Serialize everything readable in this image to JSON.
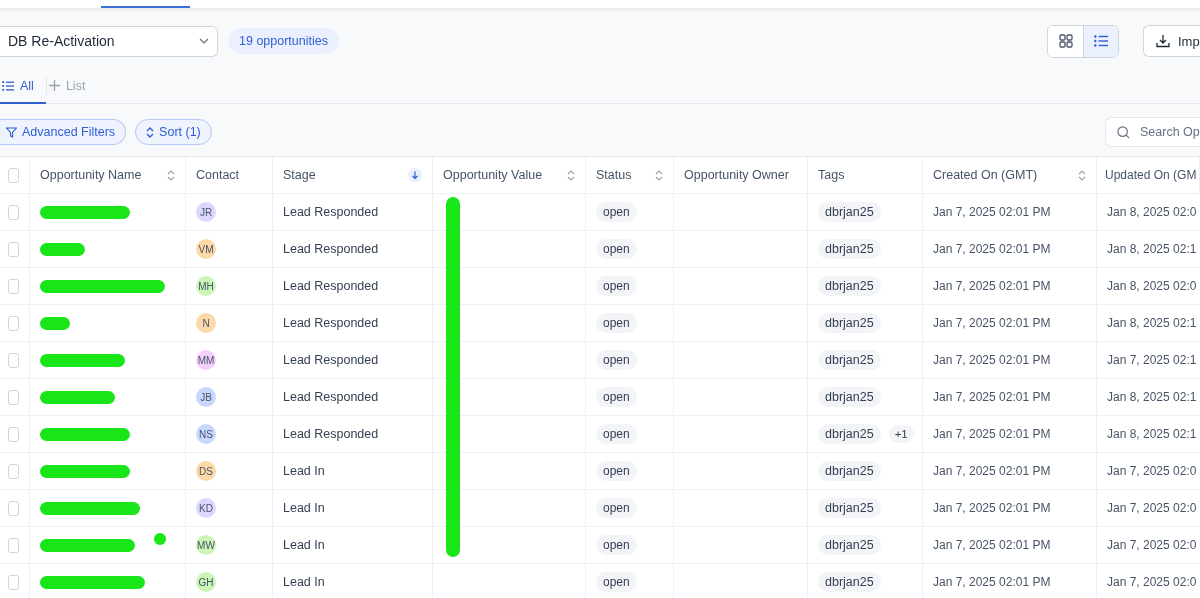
{
  "pipeline_select": {
    "value": "DB Re-Activation"
  },
  "count_badge": "19 opportunities",
  "view_toggle": [
    {
      "kind": "grid",
      "selected": false
    },
    {
      "kind": "list",
      "selected": true
    }
  ],
  "import_button": "Imp",
  "tabs": [
    {
      "label": "All",
      "kind": "list",
      "selected": true
    },
    {
      "label": "List",
      "kind": "add",
      "selected": false
    }
  ],
  "filters": [
    {
      "label": "Advanced Filters",
      "kind": "filter"
    },
    {
      "label": "Sort (1)",
      "kind": "sort"
    }
  ],
  "search": {
    "placeholder": "Search Op"
  },
  "table": {
    "all_checked": false,
    "columns": [
      {
        "label": "Opportunity Name",
        "sortable": true,
        "sorted": false
      },
      {
        "label": "Contact",
        "sortable": false,
        "sorted": false
      },
      {
        "label": "Stage",
        "sortable": false,
        "sorted": true
      },
      {
        "label": "Opportunity Value",
        "sortable": true,
        "sorted": false
      },
      {
        "label": "Status",
        "sortable": true,
        "sorted": false
      },
      {
        "label": "Opportunity Owner",
        "sortable": false,
        "sorted": false
      },
      {
        "label": "Tags",
        "sortable": false,
        "sorted": false
      },
      {
        "label": "Created On (GMT)",
        "sortable": true,
        "sorted": false
      },
      {
        "label": "Updated On (GM",
        "sortable": false,
        "sorted": false
      }
    ],
    "rows": [
      {
        "checked": false,
        "initials": "JR",
        "color": "#ddd6fe",
        "stage": "Lead Responded",
        "status": "open",
        "tags": [
          "dbrjan25"
        ],
        "created": "Jan 7, 2025 02:01 PM",
        "updated": "Jan 8, 2025 02:0"
      },
      {
        "checked": false,
        "initials": "VM",
        "color": "#fcd9a8",
        "stage": "Lead Responded",
        "status": "open",
        "tags": [
          "dbrjan25"
        ],
        "created": "Jan 7, 2025 02:01 PM",
        "updated": "Jan 8, 2025 02:1"
      },
      {
        "checked": false,
        "initials": "MH",
        "color": "#ccf5b8",
        "stage": "Lead Responded",
        "status": "open",
        "tags": [
          "dbrjan25"
        ],
        "created": "Jan 7, 2025 02:01 PM",
        "updated": "Jan 8, 2025 02:0"
      },
      {
        "checked": false,
        "initials": "N",
        "color": "#fcd9a8",
        "stage": "Lead Responded",
        "status": "open",
        "tags": [
          "dbrjan25"
        ],
        "created": "Jan 7, 2025 02:01 PM",
        "updated": "Jan 8, 2025 02:1"
      },
      {
        "checked": false,
        "initials": "MM",
        "color": "#f5d0fe",
        "stage": "Lead Responded",
        "status": "open",
        "tags": [
          "dbrjan25"
        ],
        "created": "Jan 7, 2025 02:01 PM",
        "updated": "Jan 7, 2025 02:1"
      },
      {
        "checked": false,
        "initials": "JB",
        "color": "#c7d7fe",
        "stage": "Lead Responded",
        "status": "open",
        "tags": [
          "dbrjan25"
        ],
        "created": "Jan 7, 2025 02:01 PM",
        "updated": "Jan 8, 2025 02:1"
      },
      {
        "checked": false,
        "initials": "NS",
        "color": "#c7d7fe",
        "stage": "Lead Responded",
        "status": "open",
        "tags": [
          "dbrjan25"
        ],
        "more_tags": "+1",
        "created": "Jan 7, 2025 02:01 PM",
        "updated": "Jan 8, 2025 02:1"
      },
      {
        "checked": false,
        "initials": "DS",
        "color": "#fcd9a8",
        "stage": "Lead In",
        "status": "open",
        "tags": [
          "dbrjan25"
        ],
        "created": "Jan 7, 2025 02:01 PM",
        "updated": "Jan 7, 2025 02:0"
      },
      {
        "checked": false,
        "initials": "KD",
        "color": "#ddd6fe",
        "stage": "Lead In",
        "status": "open",
        "tags": [
          "dbrjan25"
        ],
        "created": "Jan 7, 2025 02:01 PM",
        "updated": "Jan 7, 2025 02:0"
      },
      {
        "checked": false,
        "initials": "MW",
        "color": "#ccf5b8",
        "stage": "Lead In",
        "status": "open",
        "tags": [
          "dbrjan25"
        ],
        "created": "Jan 7, 2025 02:01 PM",
        "updated": "Jan 7, 2025 02:0"
      },
      {
        "checked": false,
        "initials": "GH",
        "color": "#ccf5b8",
        "stage": "Lead In",
        "status": "open",
        "tags": [
          "dbrjan25"
        ],
        "created": "Jan 7, 2025 02:01 PM",
        "updated": "Jan 7, 2025 02:0"
      }
    ]
  }
}
